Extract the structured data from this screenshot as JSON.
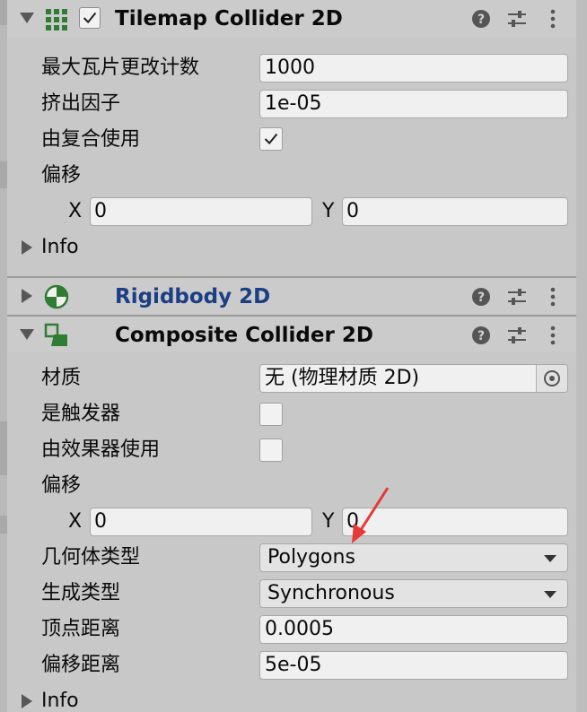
{
  "colors": {
    "panel_bg": "#c8c8c8",
    "field_bg": "#f0f0f0",
    "link_title": "#1b3e85",
    "icon_green": "#2e7d32",
    "annotation_red": "#e53935"
  },
  "tilemap_collider": {
    "title": "Tilemap Collider 2D",
    "enabled": true,
    "icon": "tilemap-collider-icon",
    "fields": {
      "max_tile_change_label": "最大瓦片更改计数",
      "max_tile_change_value": "1000",
      "extrusion_label": "挤出因子",
      "extrusion_value": "1e-05",
      "used_by_composite_label": "由复合使用",
      "used_by_composite_checked": true,
      "offset_label": "偏移",
      "offset_x_label": "X",
      "offset_x_value": "0",
      "offset_y_label": "Y",
      "offset_y_value": "0"
    },
    "info_label": "Info"
  },
  "rigidbody": {
    "title": "Rigidbody 2D",
    "icon": "rigidbody-icon",
    "expanded": false
  },
  "composite_collider": {
    "title": "Composite Collider 2D",
    "icon": "composite-collider-icon",
    "fields": {
      "material_label": "材质",
      "material_value": "无 (物理材质 2D)",
      "is_trigger_label": "是触发器",
      "is_trigger_checked": false,
      "used_by_effector_label": "由效果器使用",
      "used_by_effector_checked": false,
      "offset_label": "偏移",
      "offset_x_label": "X",
      "offset_x_value": "0",
      "offset_y_label": "Y",
      "offset_y_value": "0",
      "geometry_type_label": "几何体类型",
      "geometry_type_value": "Polygons",
      "generation_type_label": "生成类型",
      "generation_type_value": "Synchronous",
      "vertex_distance_label": "顶点距离",
      "vertex_distance_value": "0.0005",
      "offset_distance_label": "偏移距离",
      "offset_distance_value": "5e-05"
    },
    "info_label": "Info"
  },
  "header_buttons": {
    "help_icon": "help-icon",
    "preset_icon": "preset-sliders-icon",
    "menu_icon": "kebab-menu-icon"
  }
}
